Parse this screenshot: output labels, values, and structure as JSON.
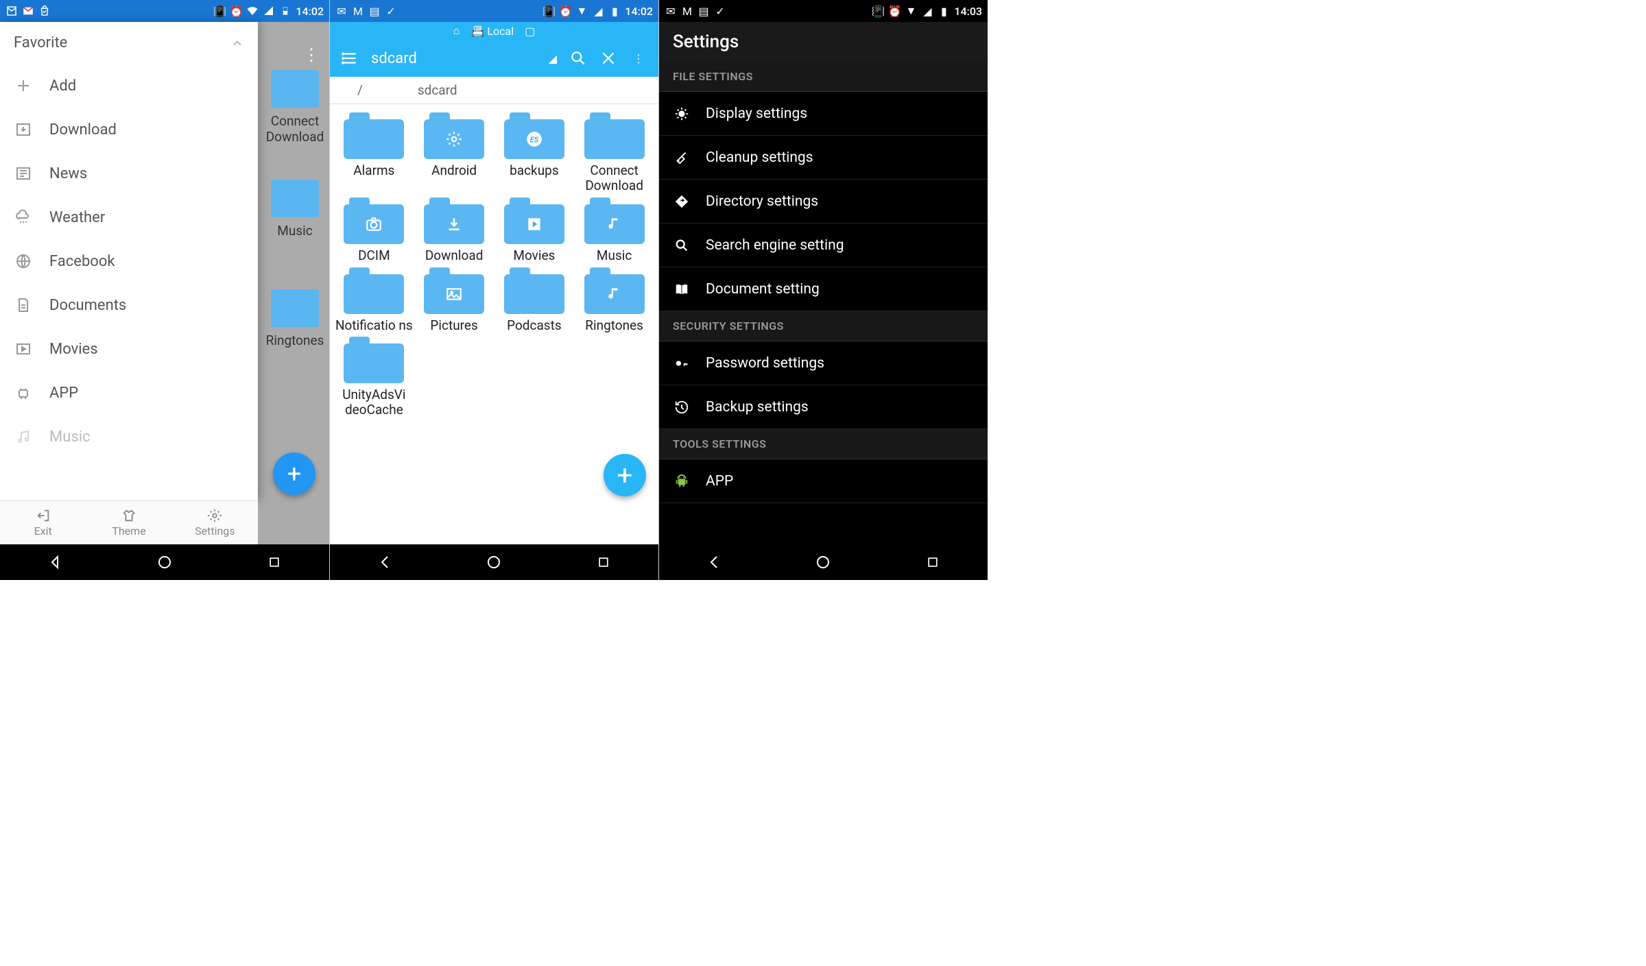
{
  "status": {
    "time_12": "14:02",
    "time_3": "14:03"
  },
  "phone1": {
    "section_title": "Favorite",
    "items": [
      {
        "label": "Add",
        "icon": "plus"
      },
      {
        "label": "Download",
        "icon": "download-box"
      },
      {
        "label": "News",
        "icon": "news"
      },
      {
        "label": "Weather",
        "icon": "cloud-rain"
      },
      {
        "label": "Facebook",
        "icon": "globe"
      },
      {
        "label": "Documents",
        "icon": "document"
      },
      {
        "label": "Movies",
        "icon": "film"
      },
      {
        "label": "APP",
        "icon": "android"
      },
      {
        "label": "Music",
        "icon": "music"
      }
    ],
    "bottom": [
      {
        "label": "Exit"
      },
      {
        "label": "Theme"
      },
      {
        "label": "Settings"
      }
    ],
    "bg_folders": [
      "Connect\nDownload",
      "Music",
      "Ringtones"
    ]
  },
  "phone2": {
    "tab_local": "Local",
    "toolbar_title": "sdcard",
    "breadcrumb_root": "/",
    "breadcrumb_current": "sdcard",
    "folders": [
      {
        "label": "Alarms",
        "overlay": ""
      },
      {
        "label": "Android",
        "overlay": "gear"
      },
      {
        "label": "backups",
        "overlay": "es"
      },
      {
        "label": "Connect Download",
        "overlay": ""
      },
      {
        "label": "DCIM",
        "overlay": "camera"
      },
      {
        "label": "Download",
        "overlay": "download"
      },
      {
        "label": "Movies",
        "overlay": "play"
      },
      {
        "label": "Music",
        "overlay": "music"
      },
      {
        "label": "Notificatio ns",
        "overlay": ""
      },
      {
        "label": "Pictures",
        "overlay": "image"
      },
      {
        "label": "Podcasts",
        "overlay": ""
      },
      {
        "label": "Ringtones",
        "overlay": "music"
      },
      {
        "label": "UnityAdsVi deoCache",
        "overlay": ""
      }
    ]
  },
  "phone3": {
    "title": "Settings",
    "sections": [
      {
        "header": "FILE SETTINGS",
        "items": [
          {
            "label": "Display settings",
            "icon": "brightness"
          },
          {
            "label": "Cleanup settings",
            "icon": "broom"
          },
          {
            "label": "Directory settings",
            "icon": "directions"
          },
          {
            "label": "Search engine setting",
            "icon": "search"
          },
          {
            "label": "Document setting",
            "icon": "book"
          }
        ]
      },
      {
        "header": "SECURITY SETTINGS",
        "items": [
          {
            "label": "Password settings",
            "icon": "key"
          },
          {
            "label": "Backup settings",
            "icon": "history"
          }
        ]
      },
      {
        "header": "TOOLS SETTINGS",
        "items": [
          {
            "label": "APP",
            "icon": "android"
          }
        ]
      }
    ]
  }
}
